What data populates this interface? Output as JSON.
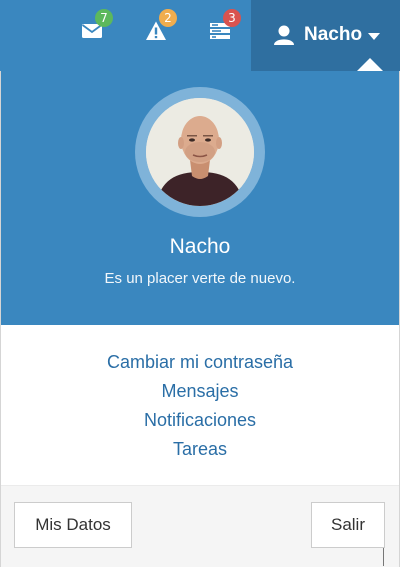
{
  "navbar": {
    "messages": {
      "icon": "envelope-icon",
      "count": "7",
      "badge_color": "#5cb85c"
    },
    "alerts": {
      "icon": "warning-icon",
      "count": "2",
      "badge_color": "#f0ad4e"
    },
    "tasks": {
      "icon": "tasks-icon",
      "count": "3",
      "badge_color": "#d9534f"
    },
    "user": {
      "icon": "user-icon",
      "name": "Nacho",
      "caret": "caret-down-icon"
    }
  },
  "dropdown": {
    "avatar": "profile-photo",
    "name": "Nacho",
    "greeting": "Es un placer verte de nuevo.",
    "links": [
      "Cambiar mi contraseña",
      "Mensajes",
      "Notificaciones",
      "Tareas"
    ],
    "footer": {
      "left_button": "Mis Datos",
      "right_button": "Salir"
    }
  },
  "colors": {
    "brand_blue": "#3a87bf",
    "link": "#2a6ea6"
  }
}
